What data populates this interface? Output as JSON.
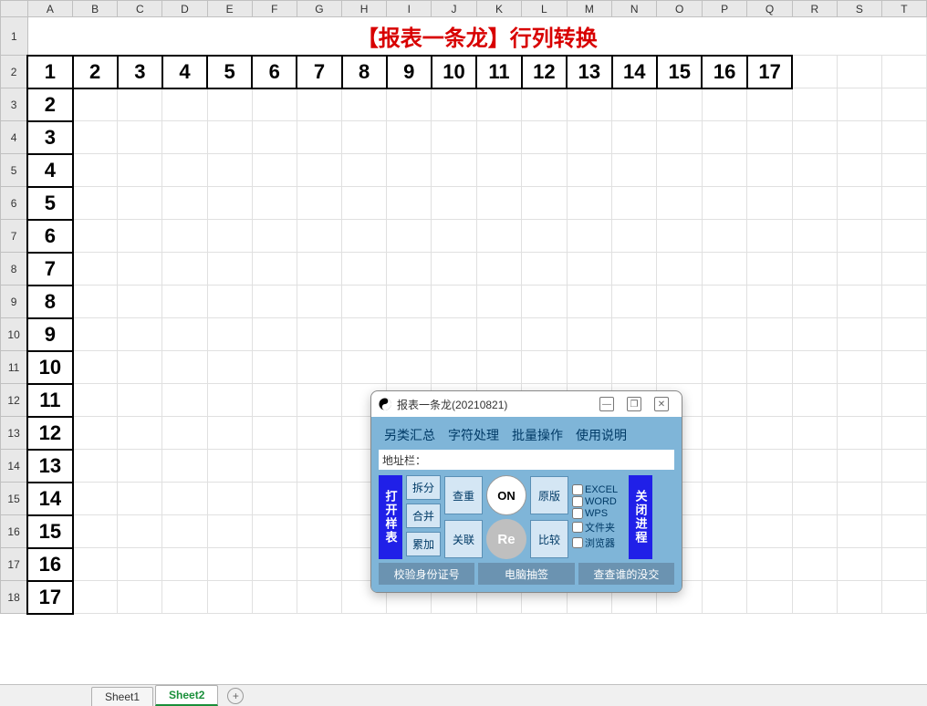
{
  "columns": [
    "A",
    "B",
    "C",
    "D",
    "E",
    "F",
    "G",
    "H",
    "I",
    "J",
    "K",
    "L",
    "M",
    "N",
    "O",
    "P",
    "Q",
    "R",
    "S",
    "T"
  ],
  "row_headers": [
    1,
    2,
    3,
    4,
    5,
    6,
    7,
    8,
    9,
    10,
    11,
    12,
    13,
    14,
    15,
    16,
    17,
    18
  ],
  "title": "【报表一条龙】行列转换",
  "row2": [
    1,
    2,
    3,
    4,
    5,
    6,
    7,
    8,
    9,
    10,
    11,
    12,
    13,
    14,
    15,
    16,
    17
  ],
  "colA_rest": [
    2,
    3,
    4,
    5,
    6,
    7,
    8,
    9,
    10,
    11,
    12,
    13,
    14,
    15,
    16,
    17
  ],
  "tabs": {
    "sheet1": "Sheet1",
    "sheet2": "Sheet2",
    "add": "+"
  },
  "dialog": {
    "title": "报表一条龙(20210821)",
    "minimize": "—",
    "restore": "❐",
    "close": "✕",
    "menu": {
      "a": "另类汇总",
      "b": "字符处理",
      "c": "批量操作",
      "d": "使用说明"
    },
    "addr_label": "地址栏：",
    "open": "打开样表",
    "close2": "关闭进程",
    "split": "拆分",
    "merge": "合并",
    "sum": "累加",
    "dup": "查重",
    "link": "关联",
    "on": "ON",
    "orig": "原版",
    "re": "Re",
    "cmp": "比较",
    "checks": {
      "excel": "EXCEL",
      "word": "WORD",
      "wps": "WPS",
      "folder": "文件夹",
      "browser": "浏览器"
    },
    "verify": "校验身份证号",
    "lottery": "电脑抽签",
    "who": "查查谁的没交"
  }
}
